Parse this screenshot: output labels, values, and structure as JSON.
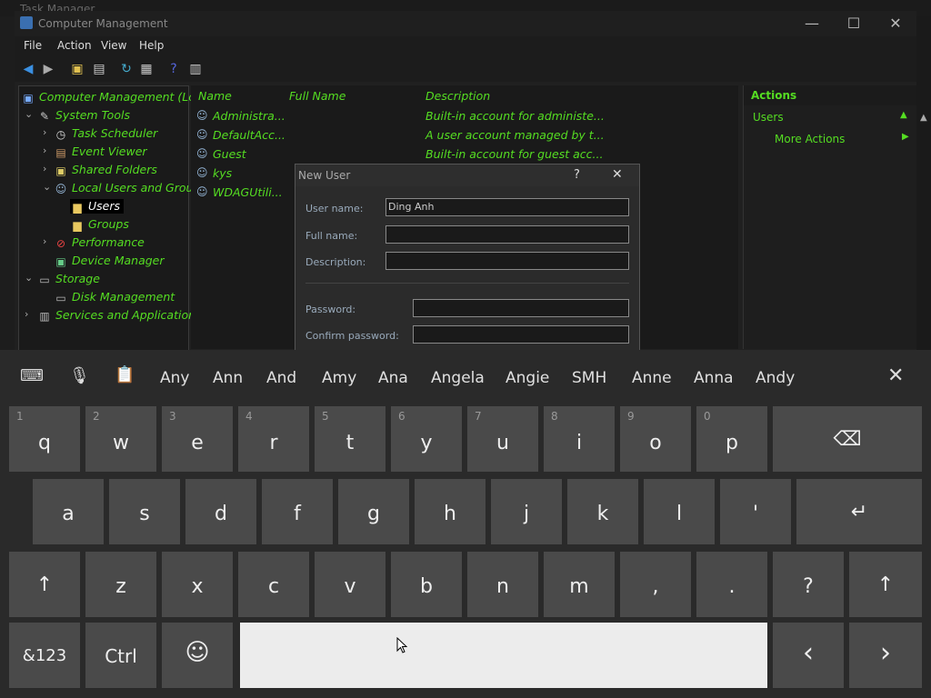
{
  "bg": {
    "title": "Task Manager"
  },
  "window": {
    "title": "Computer Management",
    "menu": [
      "File",
      "Action",
      "View",
      "Help"
    ],
    "controls": {
      "minimize": "—",
      "maximize": "☐",
      "close": "✕"
    }
  },
  "tree": [
    {
      "label": "Computer Management (Lo",
      "icon": "computer-icon"
    },
    {
      "label": "System Tools",
      "icon": "tools-icon"
    },
    {
      "label": "Task Scheduler",
      "icon": "clock-icon"
    },
    {
      "label": "Event Viewer",
      "icon": "event-viewer-icon"
    },
    {
      "label": "Shared Folders",
      "icon": "shared-folder-icon"
    },
    {
      "label": "Local Users and Grou",
      "icon": "users-icon"
    },
    {
      "label": "Users",
      "icon": "folder-icon"
    },
    {
      "label": "Groups",
      "icon": "folder-icon"
    },
    {
      "label": "Performance",
      "icon": "performance-icon"
    },
    {
      "label": "Device Manager",
      "icon": "device-manager-icon"
    },
    {
      "label": "Storage",
      "icon": "storage-icon"
    },
    {
      "label": "Disk Management",
      "icon": "disk-icon"
    },
    {
      "label": "Services and Applicatior",
      "icon": "services-icon"
    }
  ],
  "list": {
    "headers": [
      "Name",
      "Full Name",
      "Description"
    ],
    "rows": [
      {
        "name": "Administra...",
        "full": "",
        "desc": "Built-in account for administe..."
      },
      {
        "name": "DefaultAcc...",
        "full": "",
        "desc": "A user account managed by t..."
      },
      {
        "name": "Guest",
        "full": "",
        "desc": "Built-in account for guest acc..."
      },
      {
        "name": "kys",
        "full": "",
        "desc": ""
      },
      {
        "name": "WDAGUtili...",
        "full": "",
        "desc": ""
      }
    ]
  },
  "actions": {
    "title": "Actions",
    "section": "Users",
    "more": "More Actions"
  },
  "dialog": {
    "title": "New User",
    "help": "?",
    "close": "✕",
    "username_label": "User name:",
    "username_value": "Ding Anh",
    "fullname_label": "Full name:",
    "description_label": "Description:",
    "password_label": "Password:",
    "confirm_label": "Confirm password:"
  },
  "keyboard": {
    "suggestions": [
      "Any",
      "Ann",
      "And",
      "Amy",
      "Ana",
      "Angela",
      "Angie",
      "SMH",
      "Anne",
      "Anna",
      "Andy"
    ],
    "row1": [
      [
        "q",
        "1"
      ],
      [
        "w",
        "2"
      ],
      [
        "e",
        "3"
      ],
      [
        "r",
        "4"
      ],
      [
        "t",
        "5"
      ],
      [
        "y",
        "6"
      ],
      [
        "u",
        "7"
      ],
      [
        "i",
        "8"
      ],
      [
        "o",
        "9"
      ],
      [
        "p",
        "0"
      ]
    ],
    "row2": [
      "a",
      "s",
      "d",
      "f",
      "g",
      "h",
      "j",
      "k",
      "l",
      "'"
    ],
    "row3": [
      "z",
      "x",
      "c",
      "v",
      "b",
      "n",
      "m",
      ",",
      ".",
      "?"
    ],
    "backspace": "⌫",
    "enter": "↵",
    "shift": "↑",
    "symbols": "&123",
    "ctrl": "Ctrl",
    "emoji": "☺",
    "left": "‹",
    "right": "›",
    "close": "✕"
  }
}
